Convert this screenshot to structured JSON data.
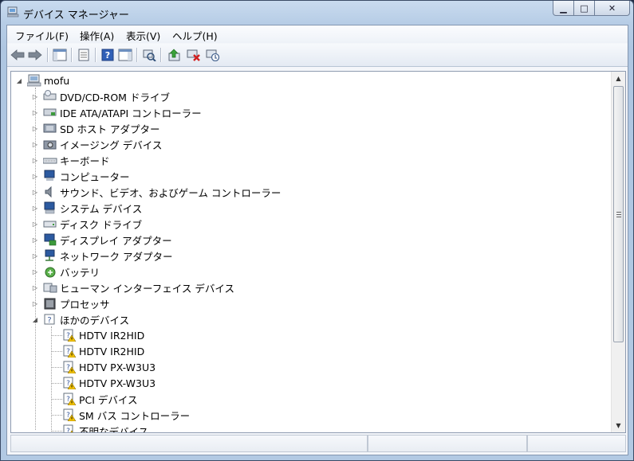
{
  "window": {
    "title": "デバイス マネージャー",
    "controls": {
      "minimize": "▁",
      "maximize": "□",
      "close": "✕"
    }
  },
  "menu": [
    "ファイル(F)",
    "操作(A)",
    "表示(V)",
    "ヘルプ(H)"
  ],
  "toolbar_icons": [
    "back-arrow-icon",
    "forward-arrow-icon",
    "show-hide-console-tree-icon",
    "properties-icon",
    "help-icon",
    "action-pane-icon",
    "scan-hardware-icon",
    "update-driver-icon",
    "uninstall-icon",
    "disable-device-icon"
  ],
  "tree": {
    "root": "mofu",
    "categories": [
      {
        "label": "DVD/CD-ROM ドライブ",
        "icon": "dvd-drive-icon"
      },
      {
        "label": "IDE ATA/ATAPI コントローラー",
        "icon": "ide-controller-icon"
      },
      {
        "label": "SD ホスト アダプター",
        "icon": "sd-host-icon"
      },
      {
        "label": "イメージング デバイス",
        "icon": "camera-icon"
      },
      {
        "label": "キーボード",
        "icon": "keyboard-icon"
      },
      {
        "label": "コンピューター",
        "icon": "computer-icon"
      },
      {
        "label": "サウンド、ビデオ、およびゲーム コントローラー",
        "icon": "speaker-icon"
      },
      {
        "label": "システム デバイス",
        "icon": "system-device-icon"
      },
      {
        "label": "ディスク ドライブ",
        "icon": "disk-drive-icon"
      },
      {
        "label": "ディスプレイ アダプター",
        "icon": "display-adapter-icon"
      },
      {
        "label": "ネットワーク アダプター",
        "icon": "network-adapter-icon"
      },
      {
        "label": "バッテリ",
        "icon": "battery-icon"
      },
      {
        "label": "ヒューマン インターフェイス デバイス",
        "icon": "hid-icon"
      },
      {
        "label": "プロセッサ",
        "icon": "processor-icon"
      },
      {
        "label": "ほかのデバイス",
        "icon": "unknown-device-icon"
      }
    ],
    "other_devices": [
      "HDTV IR2HID",
      "HDTV IR2HID",
      "HDTV PX-W3U3",
      "HDTV PX-W3U3",
      "PCI デバイス",
      "SM バス コントローラー",
      "不明なデバイス"
    ]
  },
  "colors": {
    "warning": "#f2c200",
    "window_frame": "#b7cde6"
  }
}
